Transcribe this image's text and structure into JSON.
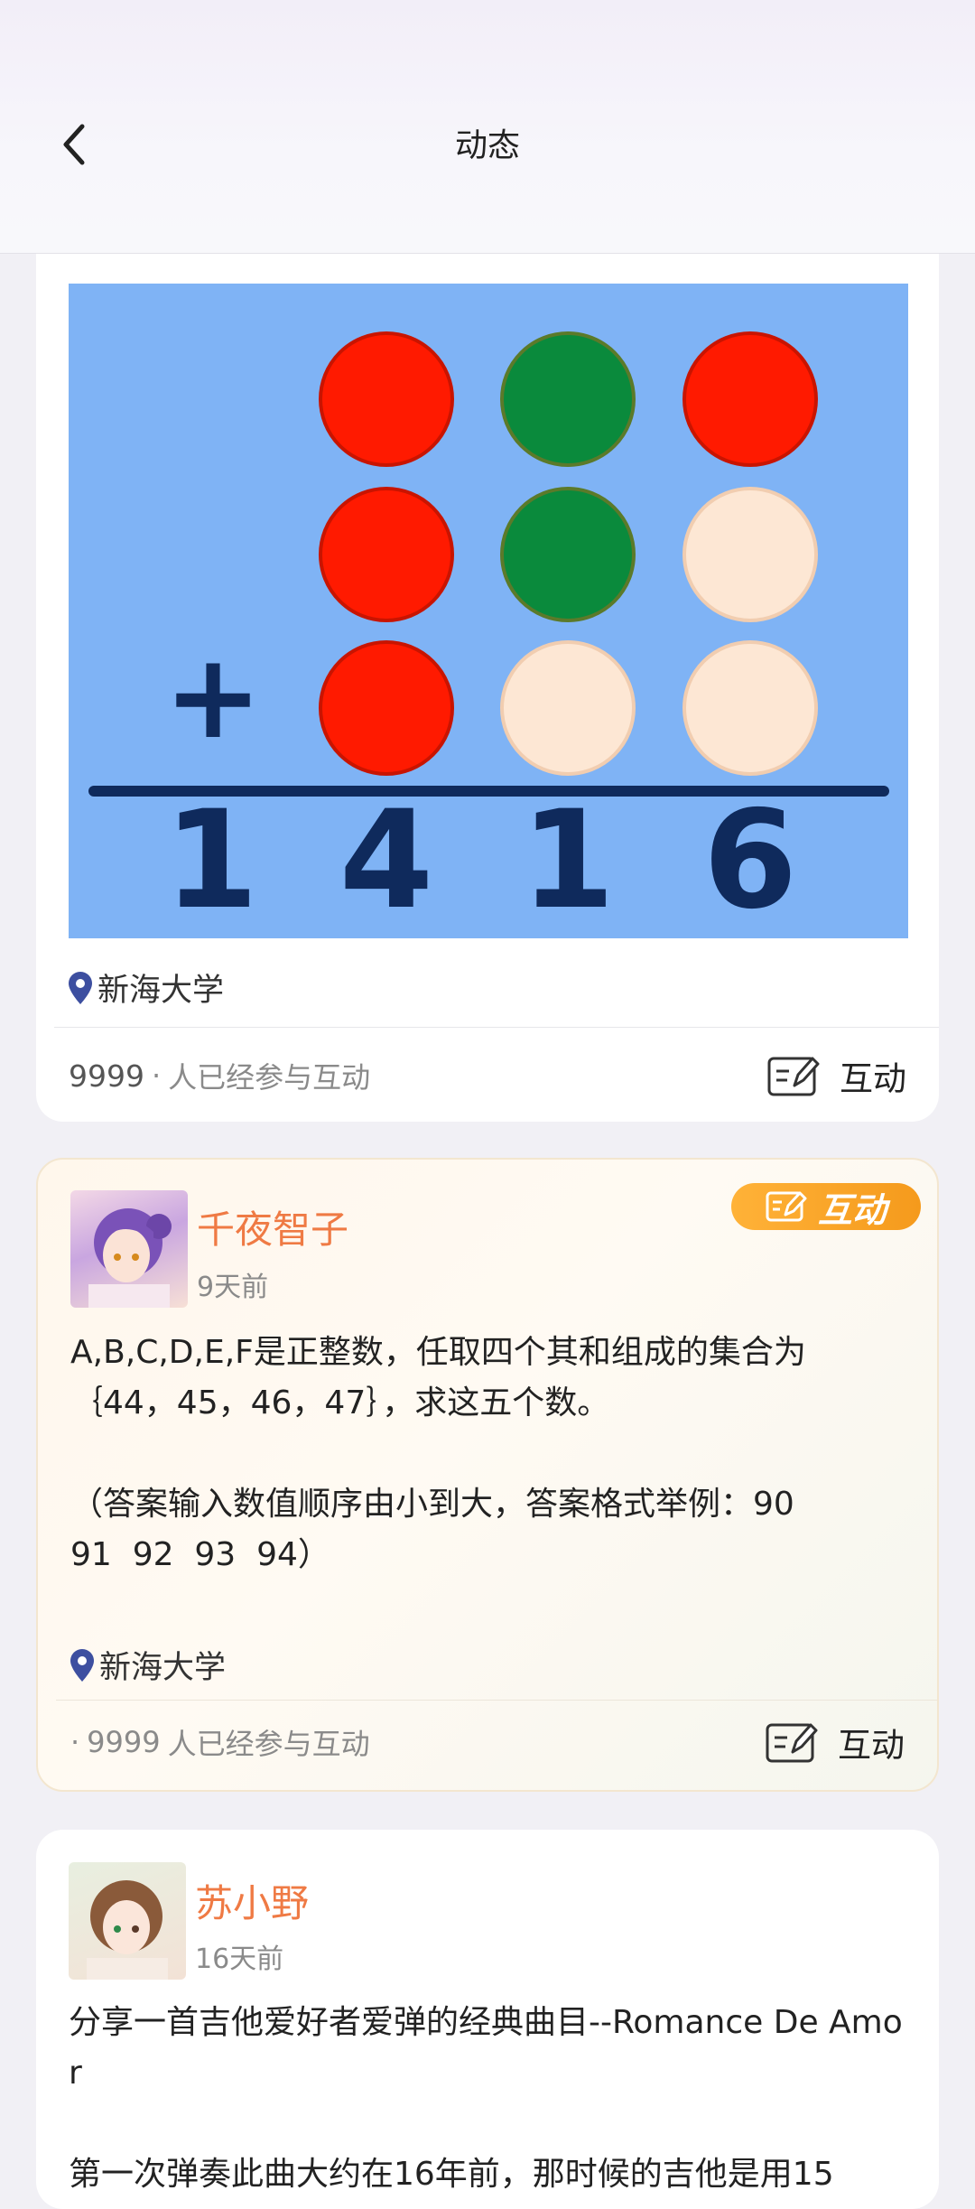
{
  "header": {
    "title": "动态"
  },
  "posts": [
    {
      "image": {
        "operator": "+",
        "result_digits": [
          "1",
          "4",
          "1",
          "6"
        ],
        "rows": [
          [
            "red",
            "green",
            "red"
          ],
          [
            "red",
            "green",
            "beige"
          ],
          [
            "red",
            "beige",
            "beige"
          ]
        ]
      },
      "location": "新海大学",
      "participants_count": "9999",
      "participants_sep": "·",
      "participants_label": "人已经参与互动",
      "interact_label": "互动"
    },
    {
      "badge_label": "互动",
      "username": "千夜智子",
      "time": "9天前",
      "text": "A,B,C,D,E,F是正整数，任取四个其和组成的集合为\n｛44，45，46，47｝，求这五个数。\n\n（答案输入数值顺序由小到大，答案格式举例：90\n91  92  93  94）",
      "location": "新海大学",
      "participants_sep": "·",
      "participants_count": "9999",
      "participants_label": "人已经参与互动",
      "interact_label": "互动"
    },
    {
      "username": "苏小野",
      "time": "16天前",
      "text": "分享一首吉他爱好者爱弹的经典曲目--Romance De Amor\n\n第一次弹奏此曲大约在16年前，那时候的吉他是用15"
    }
  ],
  "colors": {
    "accent": "#ef7a44",
    "badge": "#f7a52a",
    "image_bg": "#7fb3f5",
    "red": "#ff1a00",
    "green": "#0a8a3c",
    "beige": "#fde7d4",
    "ink": "#0f2a5c"
  }
}
